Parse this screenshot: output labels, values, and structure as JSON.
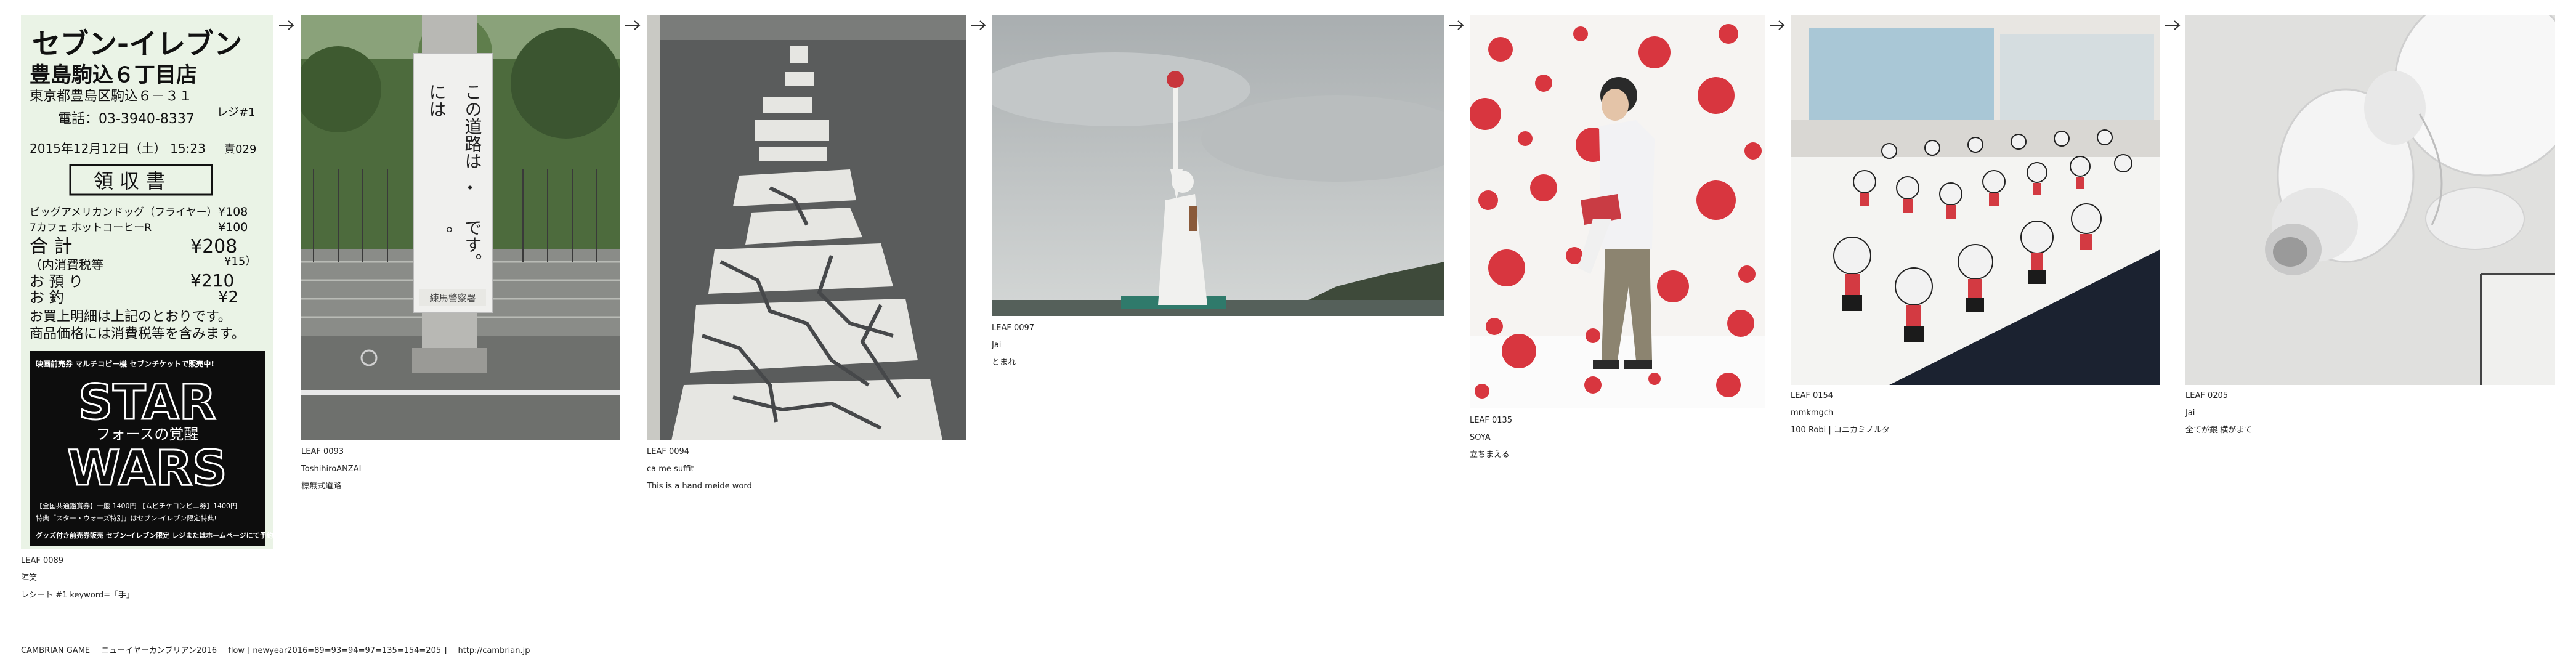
{
  "leaves": [
    {
      "id": "LEAF 0089",
      "author": "陣笑",
      "title": "レシート #1 keyword=「手」",
      "image": "receipt-photo",
      "receipt": {
        "store_line1": "セブン-イレブン",
        "store_line2": "豊島駒込６丁目店",
        "address": "東京都豊島区駒込６－３１",
        "phone": "電話：03-3940-8337",
        "register": "レジ#1",
        "datetime": "2015年12月12日（土） 15:23",
        "slip": "責029",
        "heading": "領 収 書",
        "items": [
          {
            "name": "ビッグアメリカンドッグ（フライヤー）",
            "price": "¥108"
          },
          {
            "name": "7カフェ ホットコーヒーR",
            "price": "¥100"
          }
        ],
        "total_label": "合 計",
        "total": "¥208",
        "tax_label": "（内消費税等",
        "tax": "¥15）",
        "paid_label": "お 預 り",
        "paid": "¥210",
        "change_label": "お 釣",
        "change": "¥2",
        "note1": "お買上明細は上記のとおりです。",
        "note2": "商品価格には消費税等を含みます。",
        "ad_top": "映画前売券 マルチコピー機 セブンチケットで販売中!",
        "ad_title1": "STAR",
        "ad_subtitle": "フォースの覚醒",
        "ad_title2": "WARS",
        "ad_price": "【全国共通鑑賞券】一般 1400円 【ムビチケコンビニ券】1400円",
        "ad_bonus": "特典「スター・ウォーズ特別」はセブン-イレブン限定特典!",
        "ad_bottom": "グッズ付き前売券販売 セブン-イレブン限定 レジまたはホームページにて予約受付中!"
      }
    },
    {
      "id": "LEAF 0093",
      "author": "ToshihiroANZAI",
      "title": "標無式道路",
      "image": "road-sign-pole-photo",
      "sign_text_right": "この道路は",
      "sign_text_left": "には",
      "sign_text_end": "です。",
      "sign_dot_mid": "・",
      "sign_dot_lower": "。",
      "sign_footer": "練馬警察署"
    },
    {
      "id": "LEAF 0094",
      "author": "ca me suffit",
      "title": "This is a hand meide word",
      "image": "cracked-road-marking-photo"
    },
    {
      "id": "LEAF 0097",
      "author": "Jai",
      "title": "とまれ",
      "image": "statue-of-liberty-replica-photo"
    },
    {
      "id": "LEAF 0135",
      "author": "SOYA",
      "title": "立ちまえる",
      "image": "polka-dot-room-photo"
    },
    {
      "id": "LEAF 0154",
      "author": "mmkmgch",
      "title": "100 Robi | コニカミノルタ",
      "image": "robot-exhibition-photo"
    },
    {
      "id": "LEAF 0205",
      "author": "Jai",
      "title": "全てが銀 横がまて",
      "image": "white-robot-closeup-photo"
    }
  ],
  "footer": {
    "site": "CAMBRIAN GAME",
    "subtitle": "ニューイヤーカンブリアン2016",
    "flow": "flow [ newyear2016=89=93=94=97=135=154=205 ]",
    "url": "http://cambrian.jp"
  },
  "colors": {
    "polka_red": "#d8363f",
    "night_panel": "#1b2230",
    "asphalt": "#5a5c5c",
    "sky": "#bfc4c6",
    "hill": "#3e4a3a"
  }
}
